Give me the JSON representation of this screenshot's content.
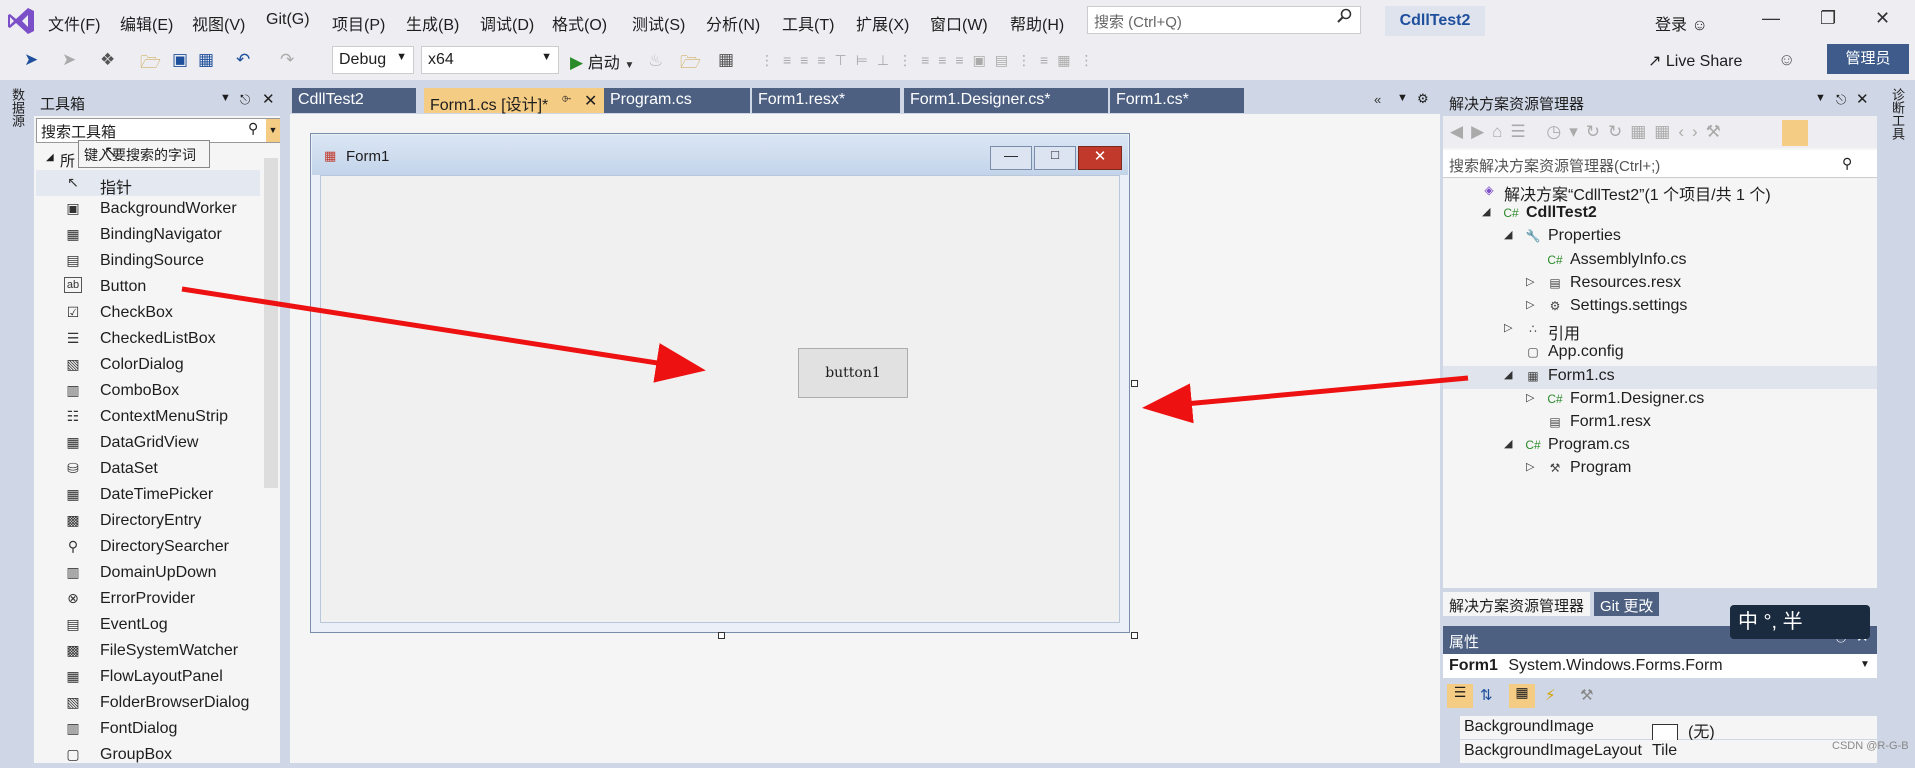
{
  "menubar": {
    "items": [
      "文件(F)",
      "编辑(E)",
      "视图(V)",
      "Git(G)",
      "项目(P)",
      "生成(B)",
      "调试(D)",
      "格式(O)",
      "测试(S)",
      "分析(N)",
      "工具(T)",
      "扩展(X)",
      "窗口(W)",
      "帮助(H)"
    ],
    "search_placeholder": "搜索 (Ctrl+Q)",
    "project_name": "CdllTest2",
    "login": "登录"
  },
  "toolbar": {
    "config": "Debug",
    "platform": "x64",
    "start": "启动",
    "live_share": "Live Share",
    "admin": "管理员"
  },
  "side_strips": {
    "left": "数据源",
    "right": "诊断工具"
  },
  "toolbox": {
    "title": "工具箱",
    "search_value": "搜索工具箱",
    "tooltip": "键入要搜索的字词",
    "group": "所",
    "items": [
      {
        "label": "指针",
        "icon": "pointer-icon"
      },
      {
        "label": "BackgroundWorker",
        "icon": "component-icon"
      },
      {
        "label": "BindingNavigator",
        "icon": "navigator-icon"
      },
      {
        "label": "BindingSource",
        "icon": "binding-icon"
      },
      {
        "label": "Button",
        "icon": "button-icon"
      },
      {
        "label": "CheckBox",
        "icon": "checkbox-icon"
      },
      {
        "label": "CheckedListBox",
        "icon": "list-icon"
      },
      {
        "label": "ColorDialog",
        "icon": "color-icon"
      },
      {
        "label": "ComboBox",
        "icon": "combo-icon"
      },
      {
        "label": "ContextMenuStrip",
        "icon": "menu-icon"
      },
      {
        "label": "DataGridView",
        "icon": "grid-icon"
      },
      {
        "label": "DataSet",
        "icon": "dataset-icon"
      },
      {
        "label": "DateTimePicker",
        "icon": "calendar-icon"
      },
      {
        "label": "DirectoryEntry",
        "icon": "directory-icon"
      },
      {
        "label": "DirectorySearcher",
        "icon": "search-icon"
      },
      {
        "label": "DomainUpDown",
        "icon": "updown-icon"
      },
      {
        "label": "ErrorProvider",
        "icon": "error-icon"
      },
      {
        "label": "EventLog",
        "icon": "log-icon"
      },
      {
        "label": "FileSystemWatcher",
        "icon": "watcher-icon"
      },
      {
        "label": "FlowLayoutPanel",
        "icon": "flow-icon"
      },
      {
        "label": "FolderBrowserDialog",
        "icon": "folder-icon"
      },
      {
        "label": "FontDialog",
        "icon": "font-icon"
      },
      {
        "label": "GroupBox",
        "icon": "groupbox-icon"
      }
    ]
  },
  "tabs": [
    {
      "label": "CdllTest2",
      "active": false
    },
    {
      "label": "Form1.cs [设计]*",
      "active": true
    },
    {
      "label": "Program.cs",
      "active": false
    },
    {
      "label": "Form1.resx*",
      "active": false
    },
    {
      "label": "Form1.Designer.cs*",
      "active": false
    },
    {
      "label": "Form1.cs*",
      "active": false
    }
  ],
  "designer": {
    "form_title": "Form1",
    "button_text": "button1"
  },
  "solution_explorer": {
    "title": "解决方案资源管理器",
    "search_placeholder": "搜索解决方案资源管理器(Ctrl+;)",
    "tree": [
      {
        "label": "解决方案“CdllTest2”(1 个项目/共 1 个)",
        "depth": 0,
        "expander": "",
        "icon": "solution-icon"
      },
      {
        "label": "CdllTest2",
        "depth": 1,
        "expander": "◢",
        "icon": "csproj-icon",
        "bold": true
      },
      {
        "label": "Properties",
        "depth": 2,
        "expander": "◢",
        "icon": "wrench-icon"
      },
      {
        "label": "AssemblyInfo.cs",
        "depth": 3,
        "expander": "",
        "icon": "csfile-icon"
      },
      {
        "label": "Resources.resx",
        "depth": 3,
        "expander": "▷",
        "icon": "resx-icon"
      },
      {
        "label": "Settings.settings",
        "depth": 3,
        "expander": "▷",
        "icon": "settings-icon"
      },
      {
        "label": "引用",
        "depth": 2,
        "expander": "▷",
        "icon": "references-icon"
      },
      {
        "label": "App.config",
        "depth": 2,
        "expander": "",
        "icon": "config-icon"
      },
      {
        "label": "Form1.cs",
        "depth": 2,
        "expander": "◢",
        "icon": "form-icon",
        "selected": true
      },
      {
        "label": "Form1.Designer.cs",
        "depth": 3,
        "expander": "▷",
        "icon": "csfile-icon"
      },
      {
        "label": "Form1.resx",
        "depth": 3,
        "expander": "",
        "icon": "resx-icon"
      },
      {
        "label": "Program.cs",
        "depth": 2,
        "expander": "◢",
        "icon": "csfile-icon"
      },
      {
        "label": "Program",
        "depth": 3,
        "expander": "▷",
        "icon": "class-icon"
      }
    ],
    "bottom_tabs": [
      "解决方案资源管理器",
      "Git 更改"
    ]
  },
  "properties": {
    "title": "属性",
    "object": "Form1",
    "type": "System.Windows.Forms.Form",
    "rows": [
      {
        "name": "BackgroundImage",
        "value": "(无)"
      },
      {
        "name": "BackgroundImageLayout",
        "value": "Tile"
      }
    ]
  },
  "ime": "中 °, 半",
  "watermark": "CSDN @R-G-B",
  "colors": {
    "accent": "#4d6082",
    "active_tab": "#f5cc84",
    "annotation_arrow": "#ee1111"
  }
}
